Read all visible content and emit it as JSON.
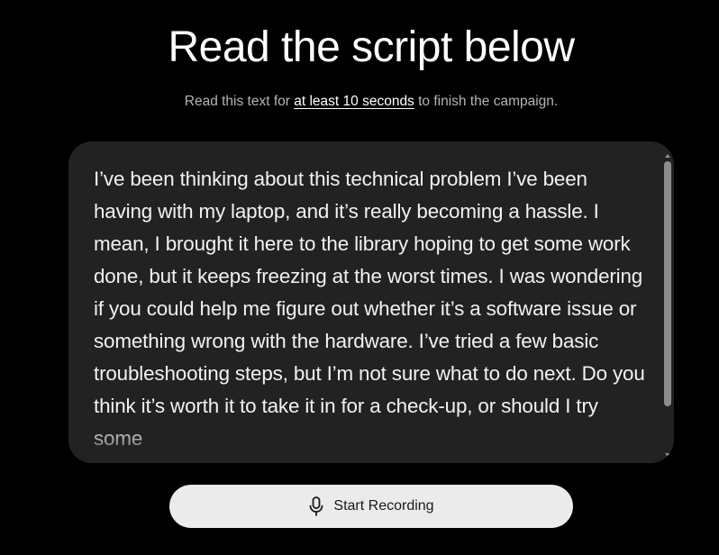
{
  "header": {
    "title": "Read the script below",
    "subtitle_prefix": "Read this text for ",
    "subtitle_emphasis": "at least 10 seconds",
    "subtitle_suffix": " to finish the campaign."
  },
  "script": {
    "text": "I’ve been thinking about this technical problem I’ve been having with my laptop, and it’s really becoming a hassle. I mean, I brought it here to the library hoping to get some work done, but it keeps freezing at the worst times. I was wondering if you could help me figure out whether it’s a software issue or something wrong with the hardware. I’ve tried a few basic troubleshooting steps, but I’m not sure what to do next. Do you think it’s worth it to take it in for a check-up, or should I try some"
  },
  "record_button": {
    "label": "Start Recording",
    "icon": "microphone-icon"
  },
  "colors": {
    "background": "#000000",
    "panel": "#222222",
    "button": "#ebebeb"
  }
}
